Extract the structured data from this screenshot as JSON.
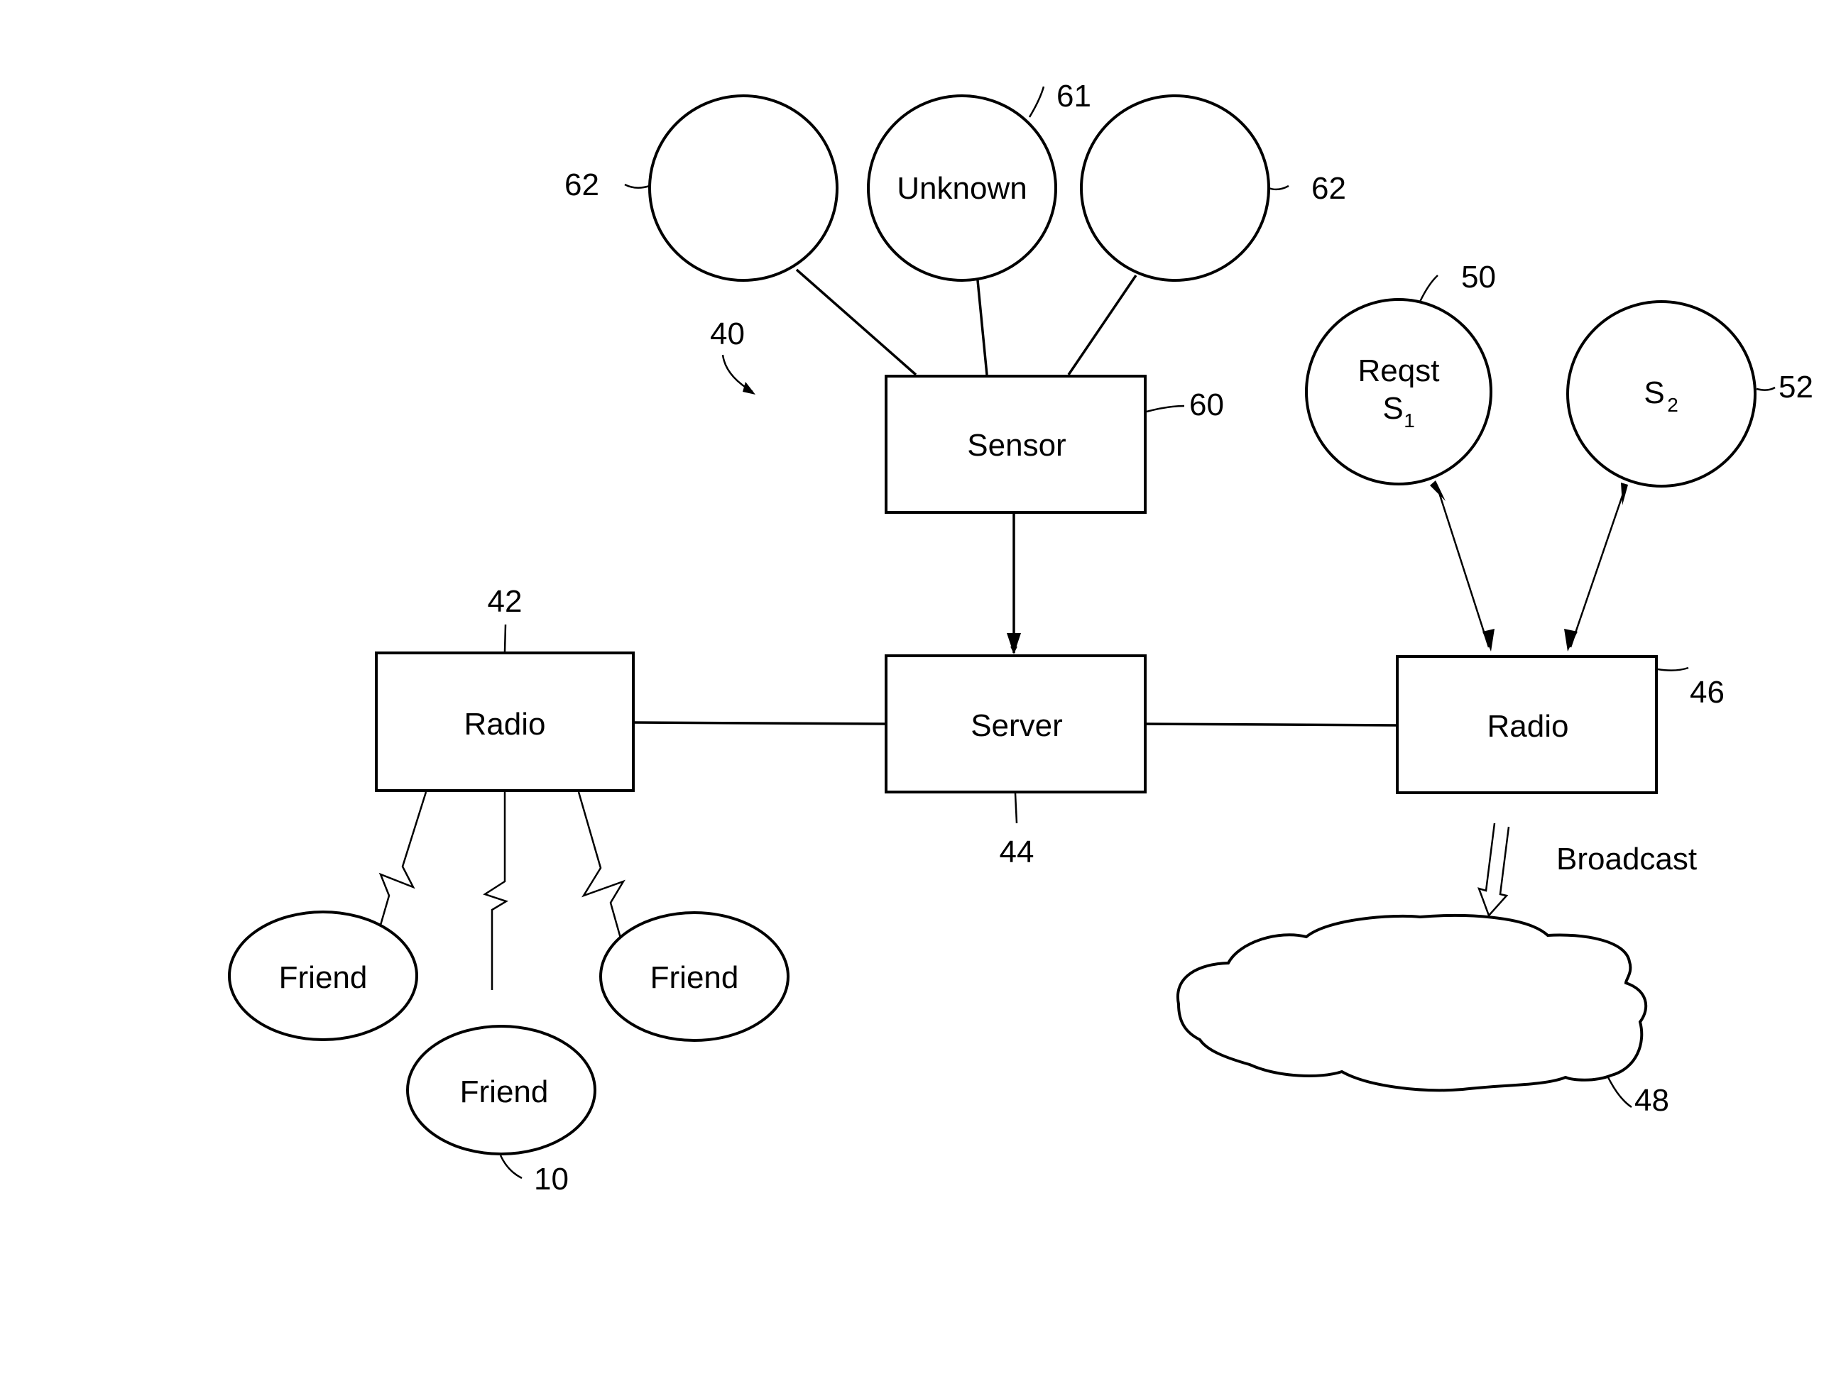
{
  "diagram": {
    "system_ref": "40",
    "nodes": {
      "target_left": {
        "label": "",
        "ref": "62"
      },
      "target_unknown": {
        "label": "Unknown",
        "ref": "61"
      },
      "target_right": {
        "label": "",
        "ref": "62"
      },
      "sensor": {
        "label": "Sensor",
        "ref": "60"
      },
      "server": {
        "label": "Server",
        "ref": "44"
      },
      "radio_left": {
        "label": "Radio",
        "ref": "42"
      },
      "radio_right": {
        "label": "Radio",
        "ref": "46"
      },
      "request_s1": {
        "label_line1": "Reqst",
        "label_line2": "S",
        "label_sub": "1",
        "ref": "50"
      },
      "s2": {
        "label": "S",
        "label_sub": "2",
        "ref": "52"
      },
      "friend_left": {
        "label": "Friend"
      },
      "friend_center": {
        "label": "Friend",
        "ref": "10"
      },
      "friend_right": {
        "label": "Friend"
      },
      "cloud": {
        "ref": "48"
      }
    },
    "broadcast_label": "Broadcast"
  }
}
